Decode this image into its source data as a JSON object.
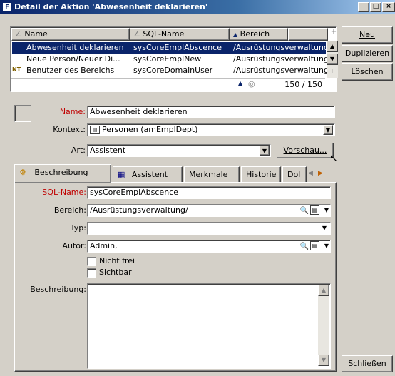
{
  "window": {
    "title": "Detail der Aktion 'Abwesenheit deklarieren'"
  },
  "list": {
    "columns": [
      "Name",
      "SQL-Name",
      "Bereich"
    ],
    "rows": [
      {
        "name": "Abwesenheit deklarieren",
        "sql": "sysCoreEmplAbscence",
        "area": "/Ausrüstungsverwaltung/",
        "selected": true
      },
      {
        "name": "Neue Person/Neuer Di...",
        "sql": "sysCoreEmplNew",
        "area": "/Ausrüstungsverwaltung/",
        "selected": false
      },
      {
        "name": "Benutzer des Bereichs",
        "sql": "sysCoreDomainUser",
        "area": "/Ausrüstungsverwaltung/",
        "selected": false
      }
    ],
    "count": "150 / 150"
  },
  "side_buttons": {
    "new": "Neu",
    "duplicate": "Duplizieren",
    "delete": "Löschen",
    "close": "Schließen"
  },
  "form": {
    "name_label": "Name:",
    "name_value": "Abwesenheit deklarieren",
    "context_label": "Kontext:",
    "context_value": "Personen (amEmplDept)",
    "type_label": "Art:",
    "type_value": "Assistent",
    "preview_button": "Vorschau..."
  },
  "tabs": [
    "Beschreibung",
    "Assistent",
    "Merkmale",
    "Historie",
    "Dol"
  ],
  "tab_body": {
    "sqlname_label": "SQL-Name:",
    "sqlname_value": "sysCoreEmplAbscence",
    "area_label": "Bereich:",
    "area_value": "/Ausrüstungsverwaltung/",
    "typ_label": "Typ:",
    "typ_value": "",
    "author_label": "Autor:",
    "author_value": "Admin,",
    "notfree_label": "Nicht frei",
    "visible_label": "Sichtbar",
    "description_label": "Beschreibung:"
  },
  "colors": {
    "selection": "#0a246a",
    "required_label": "#c00000",
    "face": "#d4d0c8"
  }
}
